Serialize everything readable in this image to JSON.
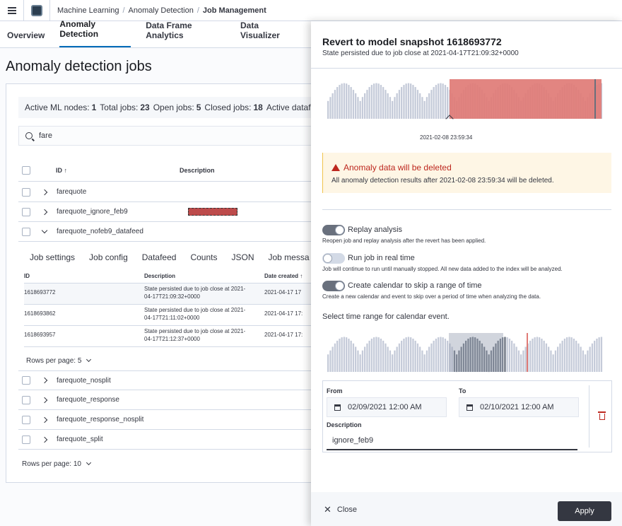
{
  "breadcrumbs": [
    "Machine Learning",
    "Anomaly Detection",
    "Job Management"
  ],
  "tabs": [
    "Overview",
    "Anomaly Detection",
    "Data Frame Analytics",
    "Data Visualizer"
  ],
  "page_title": "Anomaly detection jobs",
  "stats": {
    "active_ml_nodes_label": "Active ML nodes:",
    "active_ml_nodes": "1",
    "total_jobs_label": "Total jobs:",
    "total_jobs": "23",
    "open_jobs_label": "Open jobs:",
    "open_jobs": "5",
    "closed_jobs_label": "Closed jobs:",
    "closed_jobs": "18",
    "active_datafeeds_label": "Active datafee"
  },
  "search": {
    "value": "fare"
  },
  "table": {
    "headers": {
      "id": "ID ↑",
      "description": "Description"
    },
    "jobs": [
      "farequote",
      "farequote_ignore_feb9",
      "farequote_nofeb9_datafeed",
      "farequote_nosplit",
      "farequote_response",
      "farequote_response_nosplit",
      "farequote_split"
    ],
    "rows_per_page": "Rows per page: 10"
  },
  "expanded": {
    "tabs": [
      "Job settings",
      "Job config",
      "Datafeed",
      "Counts",
      "JSON",
      "Job messa"
    ],
    "headers": {
      "id": "ID",
      "description": "Description",
      "date": "Date created ↑"
    },
    "rows": [
      {
        "id": "1618693772",
        "desc1": "State persisted due to job close at 2021-",
        "desc2": "04-17T21:09:32+0000",
        "date": "2021-04-17 17"
      },
      {
        "id": "1618693862",
        "desc1": "State persisted due to job close at 2021-",
        "desc2": "04-17T21:11:02+0000",
        "date": "2021-04-17 17:"
      },
      {
        "id": "1618693957",
        "desc1": "State persisted due to job close at 2021-",
        "desc2": "04-17T21:12:37+0000",
        "date": "2021-04-17 17:"
      }
    ],
    "rows_per_page": "Rows per page: 5"
  },
  "flyout": {
    "title": "Revert to model snapshot 1618693772",
    "subtitle": "State persisted due to job close at 2021-04-17T21:09:32+0000",
    "chart_date": "2021-02-08 23:59:34",
    "callout_title": "Anomaly data will be deleted",
    "callout_text": "All anomaly detection results after 2021-02-08 23:59:34 will be deleted.",
    "replay_label": "Replay analysis",
    "replay_help": "Reopen job and replay analysis after the revert has been applied.",
    "realtime_label": "Run job in real time",
    "realtime_help": "Job will continue to run until manually stopped. All new data added to the index will be analyzed.",
    "calendar_label": "Create calendar to skip a range of time",
    "calendar_help": "Create a new calendar and event to skip over a period of time when analyzing the data.",
    "time_range_label": "Select time range for calendar event.",
    "from_label": "From",
    "from_value": "02/09/2021 12:00 AM",
    "to_label": "To",
    "to_value": "02/10/2021 12:00 AM",
    "description_label": "Description",
    "description_value": "ignore_feb9",
    "close_label": "Close",
    "apply_label": "Apply"
  },
  "colors": {
    "accent": "#006bb8",
    "danger": "#bd271e",
    "deleted_region": "#e07b76",
    "bar": "#c5cbd9",
    "highlight": "#98a2b3"
  }
}
